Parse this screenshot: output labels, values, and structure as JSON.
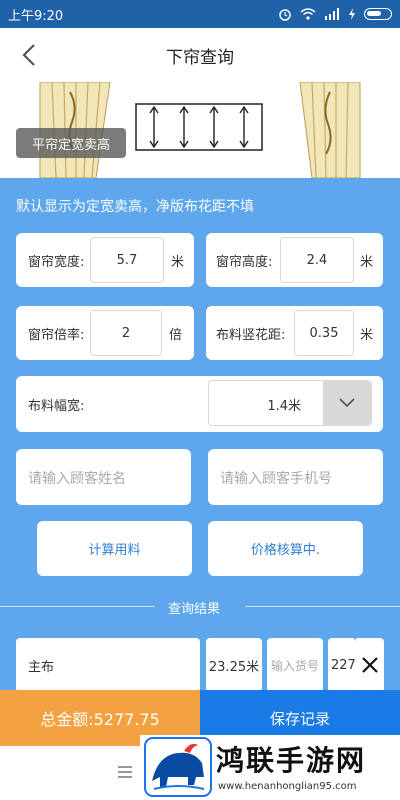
{
  "status_bar": {
    "time": "上午9:20"
  },
  "header": {
    "title": "下帘查询"
  },
  "illustration": {
    "mode_badge": "平帘定宽卖高"
  },
  "form": {
    "hint": "默认显示为定宽卖高，净版布花距不填",
    "width": {
      "label": "窗帘宽度:",
      "value": "5.7",
      "unit": "米"
    },
    "height": {
      "label": "窗帘高度:",
      "value": "2.4",
      "unit": "米"
    },
    "ratio": {
      "label": "窗帘倍率:",
      "value": "2",
      "unit": "倍"
    },
    "pattern": {
      "label": "布料竖花距:",
      "value": "0.35",
      "unit": "米"
    },
    "fabric_width": {
      "label": "布料幅宽:",
      "value": "1.4米"
    },
    "customer_name": {
      "placeholder": "请输入顾客姓名"
    },
    "customer_phone": {
      "placeholder": "请输入顾客手机号"
    },
    "calc_button": "计算用料",
    "price_button": "价格核算中."
  },
  "results": {
    "section_title": "查询结果",
    "rows": [
      {
        "name": "主布",
        "amount": "23.25米",
        "code_placeholder": "输入货号",
        "price": "227"
      }
    ]
  },
  "footer": {
    "total": "总金额:5277.75",
    "save": "保存记录"
  },
  "watermark": {
    "brand": "鸿联手游网",
    "url": "www.henanhonglian95.com"
  },
  "colors": {
    "accent": "#1a7be6",
    "panel": "#5ea7ec",
    "total_bg": "#f3a141",
    "status_bar": "#1f62a8"
  }
}
